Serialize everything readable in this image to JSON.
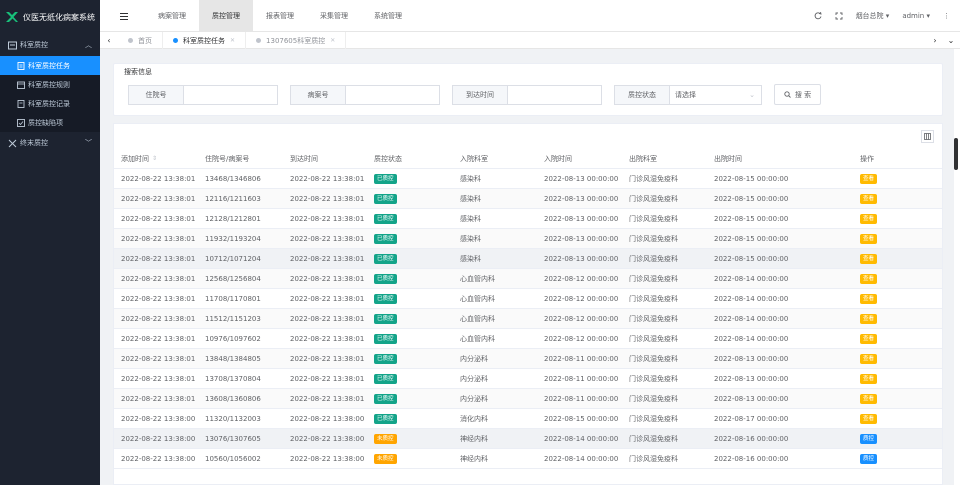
{
  "app": {
    "title": "仪医无纸化病案系统"
  },
  "sidebar": {
    "groups": [
      {
        "label": "科室质控",
        "expanded": true,
        "items": [
          {
            "label": "科室质控任务",
            "active": true
          },
          {
            "label": "科室质控规则"
          },
          {
            "label": "科室质控记录"
          },
          {
            "label": "质控缺陷项"
          }
        ]
      },
      {
        "label": "终末质控",
        "expanded": false
      }
    ]
  },
  "topnav": {
    "items": [
      {
        "label": "病案管理"
      },
      {
        "label": "质控管理",
        "active": true
      },
      {
        "label": "报表管理"
      },
      {
        "label": "采集管理"
      },
      {
        "label": "系统管理"
      }
    ],
    "org": "烟台总院",
    "user": "admin"
  },
  "tabs": [
    {
      "label": "首页"
    },
    {
      "label": "科室质控任务",
      "active": true
    },
    {
      "label": "1307605科室质控"
    }
  ],
  "search": {
    "title": "搜索信息",
    "fields": [
      {
        "label": "住院号",
        "value": ""
      },
      {
        "label": "病案号",
        "value": ""
      },
      {
        "label": "到达时间",
        "value": ""
      },
      {
        "label": "质控状态",
        "value": "请选择"
      }
    ],
    "button": "搜 索"
  },
  "table": {
    "columns": [
      "添加时间",
      "住院号/病案号",
      "到达时间",
      "质控状态",
      "入院科室",
      "入院时间",
      "出院科室",
      "出院时间",
      "操作"
    ],
    "rows": [
      {
        "c": [
          "2022-08-22 13:38:01",
          "13468/1346806",
          "2022-08-22 13:38:01",
          "已质控",
          "感染科",
          "2022-08-13 00:00:00",
          "门诊风湿免疫科",
          "2022-08-15 00:00:00",
          "查看"
        ],
        "done": true
      },
      {
        "c": [
          "2022-08-22 13:38:01",
          "12116/1211603",
          "2022-08-22 13:38:01",
          "已质控",
          "感染科",
          "2022-08-13 00:00:00",
          "门诊风湿免疫科",
          "2022-08-15 00:00:00",
          "查看"
        ],
        "done": true
      },
      {
        "c": [
          "2022-08-22 13:38:01",
          "12128/1212801",
          "2022-08-22 13:38:01",
          "已质控",
          "感染科",
          "2022-08-13 00:00:00",
          "门诊风湿免疫科",
          "2022-08-15 00:00:00",
          "查看"
        ],
        "done": true
      },
      {
        "c": [
          "2022-08-22 13:38:01",
          "11932/1193204",
          "2022-08-22 13:38:01",
          "已质控",
          "感染科",
          "2022-08-13 00:00:00",
          "门诊风湿免疫科",
          "2022-08-15 00:00:00",
          "查看"
        ],
        "done": true
      },
      {
        "c": [
          "2022-08-22 13:38:01",
          "10712/1071204",
          "2022-08-22 13:38:01",
          "已质控",
          "感染科",
          "2022-08-13 00:00:00",
          "门诊风湿免疫科",
          "2022-08-15 00:00:00",
          "查看"
        ],
        "done": true
      },
      {
        "c": [
          "2022-08-22 13:38:01",
          "12568/1256804",
          "2022-08-22 13:38:01",
          "已质控",
          "心血管内科",
          "2022-08-12 00:00:00",
          "门诊风湿免疫科",
          "2022-08-14 00:00:00",
          "查看"
        ],
        "done": true
      },
      {
        "c": [
          "2022-08-22 13:38:01",
          "11708/1170801",
          "2022-08-22 13:38:01",
          "已质控",
          "心血管内科",
          "2022-08-12 00:00:00",
          "门诊风湿免疫科",
          "2022-08-14 00:00:00",
          "查看"
        ],
        "done": true
      },
      {
        "c": [
          "2022-08-22 13:38:01",
          "11512/1151203",
          "2022-08-22 13:38:01",
          "已质控",
          "心血管内科",
          "2022-08-12 00:00:00",
          "门诊风湿免疫科",
          "2022-08-14 00:00:00",
          "查看"
        ],
        "done": true
      },
      {
        "c": [
          "2022-08-22 13:38:01",
          "10976/1097602",
          "2022-08-22 13:38:01",
          "已质控",
          "心血管内科",
          "2022-08-12 00:00:00",
          "门诊风湿免疫科",
          "2022-08-14 00:00:00",
          "查看"
        ],
        "done": true
      },
      {
        "c": [
          "2022-08-22 13:38:01",
          "13848/1384805",
          "2022-08-22 13:38:01",
          "已质控",
          "内分泌科",
          "2022-08-11 00:00:00",
          "门诊风湿免疫科",
          "2022-08-13 00:00:00",
          "查看"
        ],
        "done": true
      },
      {
        "c": [
          "2022-08-22 13:38:01",
          "13708/1370804",
          "2022-08-22 13:38:01",
          "已质控",
          "内分泌科",
          "2022-08-11 00:00:00",
          "门诊风湿免疫科",
          "2022-08-13 00:00:00",
          "查看"
        ],
        "done": true
      },
      {
        "c": [
          "2022-08-22 13:38:01",
          "13608/1360806",
          "2022-08-22 13:38:01",
          "已质控",
          "内分泌科",
          "2022-08-11 00:00:00",
          "门诊风湿免疫科",
          "2022-08-13 00:00:00",
          "查看"
        ],
        "done": true
      },
      {
        "c": [
          "2022-08-22 13:38:00",
          "11320/1132003",
          "2022-08-22 13:38:00",
          "已质控",
          "消化内科",
          "2022-08-15 00:00:00",
          "门诊风湿免疫科",
          "2022-08-17 00:00:00",
          "查看"
        ],
        "done": true
      },
      {
        "c": [
          "2022-08-22 13:38:00",
          "13076/1307605",
          "2022-08-22 13:38:00",
          "未质控",
          "神经内科",
          "2022-08-14 00:00:00",
          "门诊风湿免疫科",
          "2022-08-16 00:00:00",
          "质控"
        ],
        "done": false
      },
      {
        "c": [
          "2022-08-22 13:38:00",
          "10560/1056002",
          "2022-08-22 13:38:00",
          "未质控",
          "神经内科",
          "2022-08-14 00:00:00",
          "门诊风湿免疫科",
          "2022-08-16 00:00:00",
          "质控"
        ],
        "done": false
      }
    ]
  },
  "colors": {
    "sidebar_bg": "#1d2330",
    "accent": "#1890ff",
    "done": "#13a489",
    "todo": "#ffa500",
    "view_btn": "#ffba00"
  },
  "icons": {
    "logo": "logo-icon",
    "hamburger": "hamburger-icon",
    "refresh": "refresh-icon",
    "fullscreen": "fullscreen-icon",
    "more": "more-icon",
    "columns": "columns-icon"
  }
}
